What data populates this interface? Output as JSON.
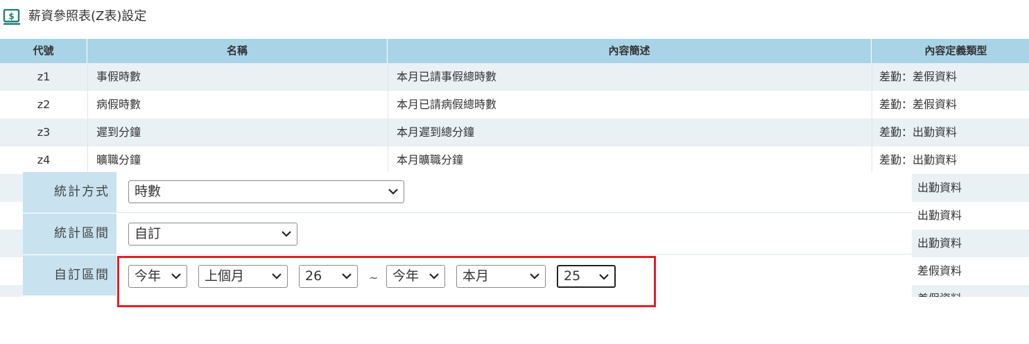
{
  "header": {
    "title": "薪資參照表(Z表)設定",
    "icon": "money-icon",
    "accent": "#1e7f7a"
  },
  "table": {
    "columns": [
      "代號",
      "名稱",
      "內容簡述",
      "內容定義類型"
    ],
    "rows": [
      {
        "code": "z1",
        "name": "事假時數",
        "desc": "本月已請事假總時數",
        "type": "差勤：差假資料"
      },
      {
        "code": "z2",
        "name": "病假時數",
        "desc": "本月已請病假總時數",
        "type": "差勤：差假資料"
      },
      {
        "code": "z3",
        "name": "遲到分鐘",
        "desc": "本月遲到總分鐘",
        "type": "差勤：出勤資料"
      },
      {
        "code": "z4",
        "name": "曠職分鐘",
        "desc": "本月曠職分鐘",
        "type": "差勤：出勤資料"
      }
    ],
    "partial_types": [
      "出勤資料",
      "出勤資料",
      "出勤資料",
      "差假資料",
      "差假資料"
    ]
  },
  "form": {
    "stat_method": {
      "label": "統計方式",
      "value": "時數"
    },
    "stat_range": {
      "label": "統計區間",
      "value": "自訂"
    },
    "custom_range": {
      "label": "自訂區間",
      "from_year": "今年",
      "from_month": "上個月",
      "from_day": "26",
      "separator": "~",
      "to_year": "今年",
      "to_month": "本月",
      "to_day": "25"
    }
  },
  "colors": {
    "header_bg": "#a9d4e8",
    "label_bg": "#c8e2ef",
    "highlight": "#e01f26"
  }
}
